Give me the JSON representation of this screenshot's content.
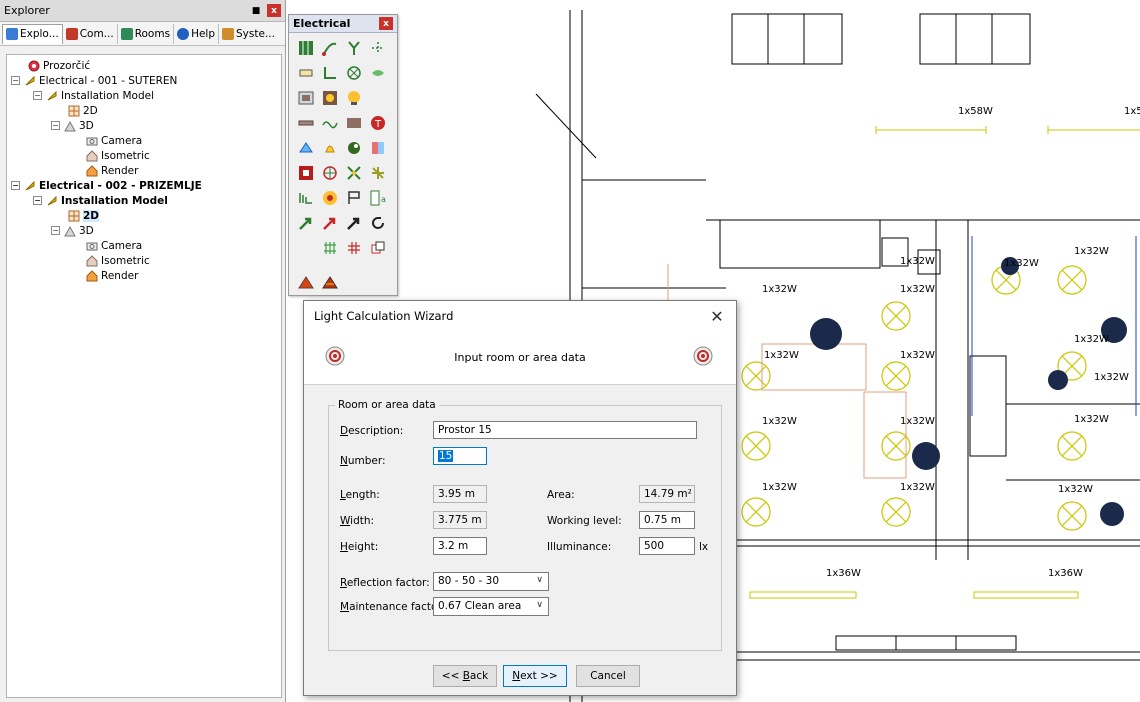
{
  "explorer": {
    "title": "Explorer",
    "pin": "■",
    "close": "x",
    "tabs": [
      {
        "label": "Explo...",
        "icon": "tree-icon",
        "active": true
      },
      {
        "label": "Com...",
        "icon": "components-icon",
        "active": false
      },
      {
        "label": "Rooms",
        "icon": "rooms-icon",
        "active": false
      },
      {
        "label": "Help",
        "icon": "help-icon",
        "active": false
      },
      {
        "label": "Syste...",
        "icon": "system-icon",
        "active": false
      }
    ],
    "tree": [
      {
        "label": "Prozorčić",
        "icon": "project-icon"
      },
      {
        "label": "Electrical - 001 - SUTEREN",
        "icon": "electrical-icon",
        "expander": "−"
      },
      {
        "label": "Installation Model",
        "icon": "electrical-icon",
        "expander": "−"
      },
      {
        "label": "2D",
        "icon": "2d-view-icon"
      },
      {
        "label": "3D",
        "icon": "3d-view-icon",
        "expander": "−"
      },
      {
        "label": "Camera",
        "icon": "camera-icon"
      },
      {
        "label": "Isometric",
        "icon": "isometric-icon"
      },
      {
        "label": "Render",
        "icon": "render-icon"
      },
      {
        "label": "Electrical - 002 - PRIZEMLJE",
        "icon": "electrical-icon",
        "expander": "−",
        "bold": true
      },
      {
        "label": "Installation Model",
        "icon": "electrical-icon",
        "expander": "−",
        "bold": true
      },
      {
        "label": "2D",
        "icon": "2d-view-icon",
        "bold": true,
        "selected": true
      },
      {
        "label": "3D",
        "icon": "3d-view-icon",
        "expander": "−"
      },
      {
        "label": "Camera",
        "icon": "camera-icon"
      },
      {
        "label": "Isometric",
        "icon": "isometric-icon"
      },
      {
        "label": "Render",
        "icon": "render-icon"
      }
    ]
  },
  "palette": {
    "title": "Electrical",
    "close": "x",
    "icons": [
      "distribution-board-icon",
      "cable-icon",
      "junction-icon",
      "connector-icon",
      "socket-icon",
      "switch-icon",
      "lamp-icon",
      "sensor-icon",
      "panel-icon",
      "photo-icon",
      "bulb-icon",
      "line-icon",
      "wave-icon",
      "box-icon",
      "transformer-icon",
      "alarm-icon",
      "bell-icon",
      "motion-icon",
      "contact-icon",
      "fuse-icon",
      "network-icon",
      "tree-node-icon",
      "spark-icon",
      "grid-icon",
      "smoke-icon",
      "flag-icon",
      "label-icon",
      "arrow-green-icon",
      "arrow-red-icon",
      "arrow-black-icon",
      "refresh-icon",
      "hash-icon",
      "cross-icon",
      "plug-icon",
      "roof-a-icon",
      "roof-b-icon"
    ]
  },
  "drawing": {
    "labels": [
      "1x58W",
      "1x5",
      "1x32W",
      "1x32W",
      "1x32W",
      "1x32W",
      "1x32W",
      "1x32W",
      "1x32W",
      "1x32W",
      "1x32W",
      "1x32W",
      "1x32W",
      "1x32W",
      "1x32W",
      "1x32W",
      "1x32W",
      "1x36W",
      "1x36W"
    ]
  },
  "dialog": {
    "title": "Light Calculation Wizard",
    "close": "✕",
    "header": "Input room or area data",
    "group_title": "Room or area data",
    "fields": {
      "description": {
        "label_ul": "D",
        "label_rest": "escription:",
        "value": "Prostor 15"
      },
      "number": {
        "label_ul": "N",
        "label_rest": "umber:",
        "value": "15"
      },
      "length": {
        "label_ul": "L",
        "label_rest": "ength:",
        "value": "3.95 m"
      },
      "width": {
        "label_ul": "W",
        "label_rest": "idth:",
        "value": "3.775 m"
      },
      "height": {
        "label_ul": "H",
        "label_rest": "eight:",
        "value": "3.2 m"
      },
      "area": {
        "label": "Area:",
        "value": "14.79 m²"
      },
      "working_level": {
        "label": "Working level:",
        "value": "0.75 m"
      },
      "illuminance": {
        "label": "Illuminance:",
        "value": "500",
        "unit": "lx"
      },
      "reflection": {
        "label_ul": "R",
        "label_rest": "eflection factor:",
        "value": "80 - 50 - 30"
      },
      "maintenance": {
        "label_ul": "M",
        "label_rest": "aintenance factor:",
        "value": "0.67 Clean area"
      }
    },
    "buttons": {
      "back": {
        "pre": "<< ",
        "ul": "B",
        "post": "ack"
      },
      "next": {
        "pre": "",
        "ul": "N",
        "post": "ext >>"
      },
      "cancel": "Cancel"
    }
  },
  "colors": {
    "accent": "#0078d7",
    "fixture": "#c8c800",
    "danger": "#c8322b"
  }
}
